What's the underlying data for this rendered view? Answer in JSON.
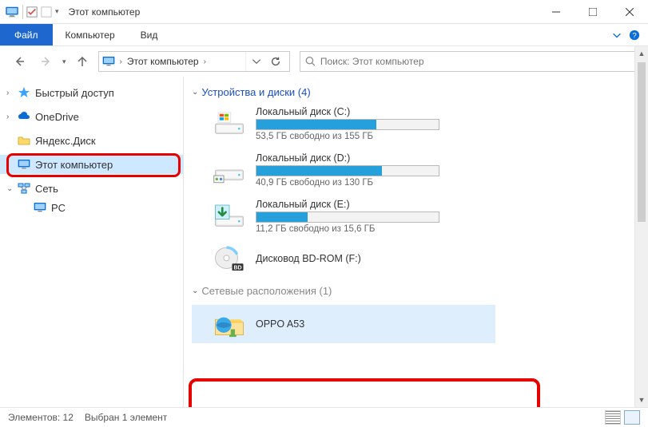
{
  "window": {
    "title": "Этот компьютер",
    "min": "—",
    "max": "☐",
    "close": "✕"
  },
  "ribbon": {
    "file": "Файл",
    "tabs": [
      "Компьютер",
      "Вид"
    ]
  },
  "address": {
    "location": "Этот компьютер"
  },
  "search": {
    "placeholder": "Поиск: Этот компьютер"
  },
  "sidebar": {
    "items": [
      {
        "label": "Быстрый доступ",
        "icon": "star",
        "chev": ">"
      },
      {
        "label": "OneDrive",
        "icon": "onedrive",
        "chev": ">"
      },
      {
        "label": "Яндекс.Диск",
        "icon": "yandex",
        "chev": ""
      },
      {
        "label": "Этот компьютер",
        "icon": "pc",
        "chev": ">",
        "selected": true
      },
      {
        "label": "Сеть",
        "icon": "network",
        "chev": "v"
      },
      {
        "label": "PC",
        "icon": "pcnode",
        "chev": "",
        "child": true
      }
    ]
  },
  "sections": {
    "devices": {
      "title": "Устройства и диски (4)"
    },
    "network": {
      "title": "Сетевые расположения (1)"
    }
  },
  "drives": [
    {
      "name": "Локальный диск (C:)",
      "free": "53,5 ГБ свободно из 155 ГБ",
      "fill": 66,
      "icon": "win"
    },
    {
      "name": "Локальный диск (D:)",
      "free": "40,9 ГБ свободно из 130 ГБ",
      "fill": 69,
      "icon": "hdd"
    },
    {
      "name": "Локальный диск (E:)",
      "free": "11,2 ГБ свободно из 15,6 ГБ",
      "fill": 28,
      "icon": "dl"
    },
    {
      "name": "Дисковод BD-ROM (F:)",
      "free": "",
      "fill": -1,
      "icon": "bd"
    }
  ],
  "network_locations": [
    {
      "name": "OPPO A53"
    }
  ],
  "status": {
    "items": "Элементов: 12",
    "selected": "Выбран 1 элемент"
  }
}
